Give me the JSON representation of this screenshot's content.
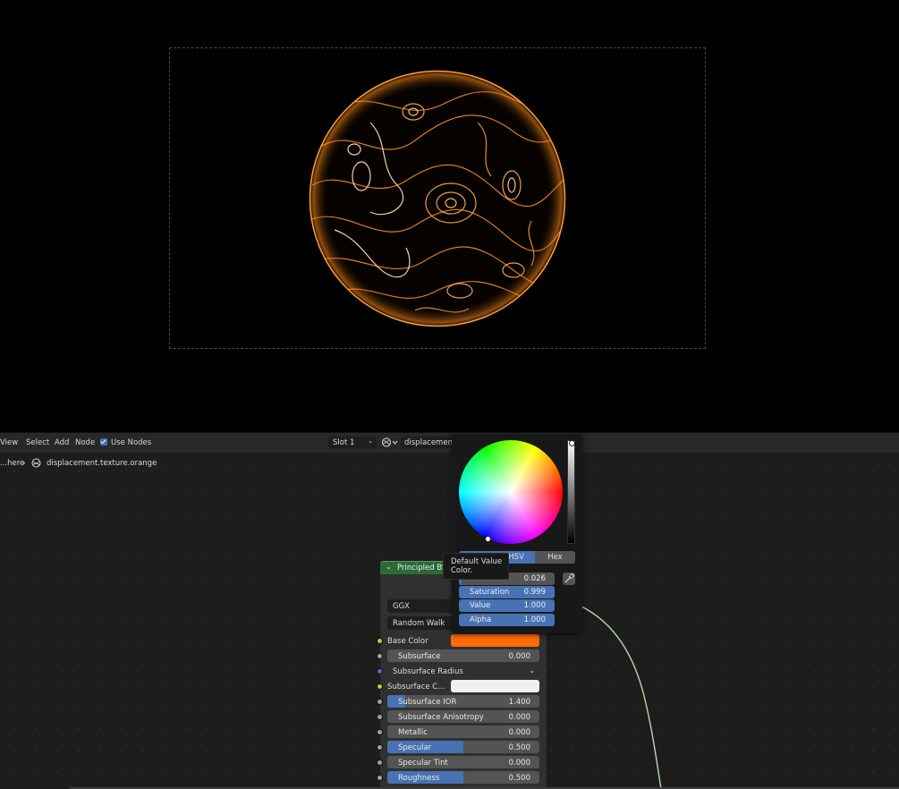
{
  "header": {
    "menu": [
      "View",
      "Select",
      "Add",
      "Node"
    ],
    "use_nodes_label": "Use Nodes",
    "slot_label": "Slot 1",
    "material_name": "displacement.texture.orange"
  },
  "breadcrumb": {
    "parent": "...here",
    "material": "displacement.texture.orange"
  },
  "node": {
    "title": "Principled BSDF",
    "distribution": "GGX",
    "subsurface_method": "Random Walk",
    "inputs": [
      {
        "label": "Base Color",
        "type": "color",
        "color": "#ff6a07"
      },
      {
        "label": "Subsurface",
        "value": "0.000",
        "fill": 0
      },
      {
        "label": "Subsurface Radius",
        "type": "dropdown"
      },
      {
        "label": "Subsurface C...",
        "type": "color",
        "color": "#f0f0f0"
      },
      {
        "label": "Subsurface IOR",
        "value": "1.400",
        "fill": 0.12
      },
      {
        "label": "Subsurface Anisotropy",
        "value": "0.000",
        "fill": 0
      },
      {
        "label": "Metallic",
        "value": "0.000",
        "fill": 0
      },
      {
        "label": "Specular",
        "value": "0.500",
        "fill": 0.5
      },
      {
        "label": "Specular Tint",
        "value": "0.000",
        "fill": 0
      },
      {
        "label": "Roughness",
        "value": "0.500",
        "fill": 0.5
      }
    ]
  },
  "color_picker": {
    "tabs": [
      "HSV",
      "Hex"
    ],
    "hue_value": "0.026",
    "saturation_label": "Saturation",
    "saturation_value": "0.999",
    "value_label": "Value",
    "value_value": "1.000",
    "alpha_label": "Alpha",
    "alpha_value": "1.000"
  },
  "tooltip": {
    "line1": "Default Value",
    "line2": "Color."
  },
  "colors": {
    "accent": "#4772b3",
    "node_header": "#2a6b35",
    "base_color": "#ff6a07",
    "planet_glow": "#ff8c1a"
  }
}
